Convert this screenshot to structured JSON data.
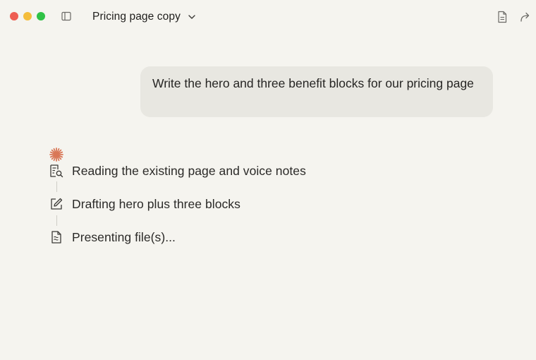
{
  "window": {
    "title": "Pricing page copy"
  },
  "conversation": {
    "user_message": "Write the hero and three benefit blocks for our pricing page",
    "steps": [
      {
        "label": "Reading the existing page and voice notes",
        "icon": "document-search-icon"
      },
      {
        "label": "Drafting hero plus three blocks",
        "icon": "edit-icon"
      },
      {
        "label": "Presenting file(s)...",
        "icon": "file-icon"
      }
    ]
  },
  "colors": {
    "background": "#f5f4ef",
    "bubble": "#e8e7e1",
    "accent": "#d97757",
    "close": "#ee5d52",
    "minimize": "#f4bd3b",
    "maximize": "#2fc246"
  }
}
